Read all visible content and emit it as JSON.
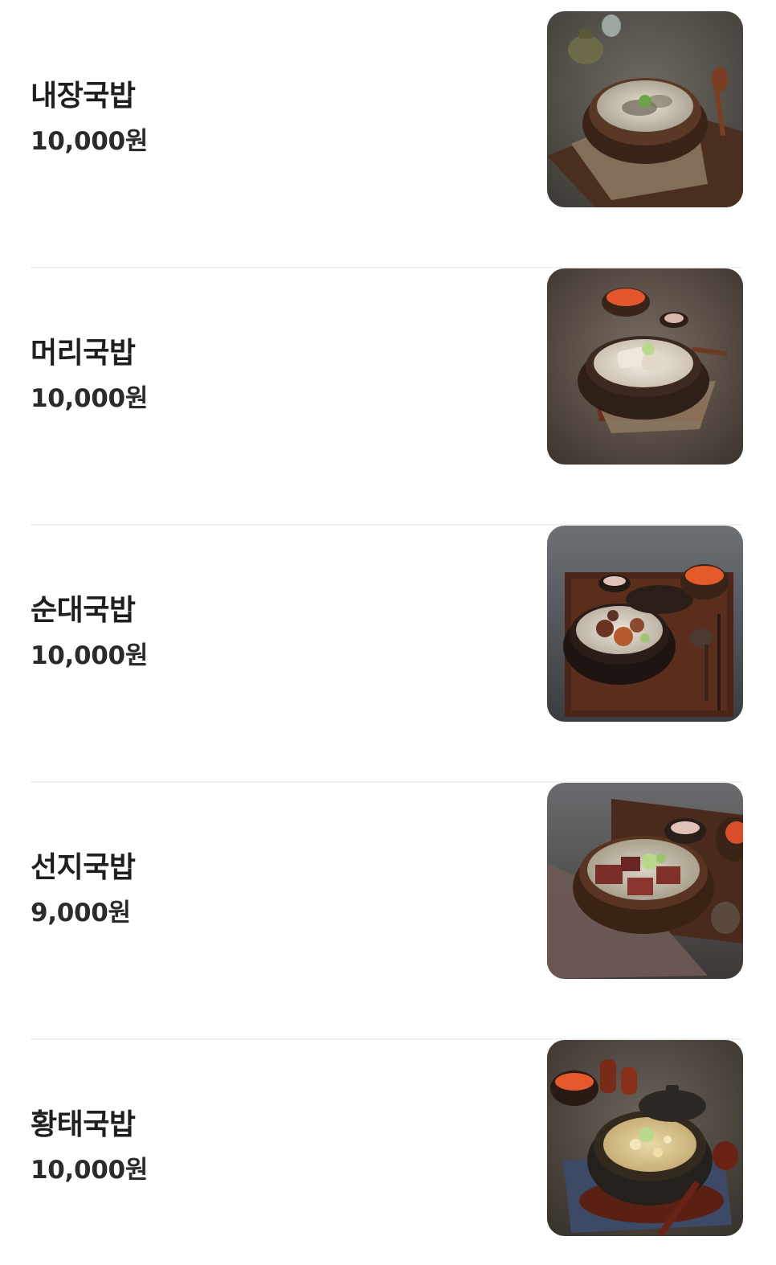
{
  "menu": {
    "items": [
      {
        "name": "내장국밥",
        "price": "10,000원",
        "image": "naejang-gukbap-photo"
      },
      {
        "name": "머리국밥",
        "price": "10,000원",
        "image": "meori-gukbap-photo"
      },
      {
        "name": "순대국밥",
        "price": "10,000원",
        "image": "sundae-gukbap-photo"
      },
      {
        "name": "선지국밥",
        "price": "9,000원",
        "image": "seonji-gukbap-photo"
      },
      {
        "name": "황태국밥",
        "price": "10,000원",
        "image": "hwangtae-gukbap-photo"
      }
    ]
  },
  "colors": {
    "background": "#ffffff",
    "text": "#1f1f1f",
    "divider": "#f1f1f1"
  }
}
